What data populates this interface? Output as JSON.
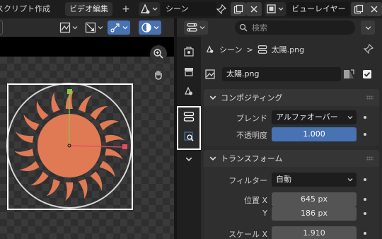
{
  "topbar": {
    "tab_partial": "スクリプト作成",
    "tab_active": "ビデオ編集",
    "plus": "+",
    "scene_name": "シーン",
    "layer_name": "ビューレイヤー"
  },
  "viewport": {
    "toolbar_icons": [
      "overlay-icon",
      "gizmo-icon",
      "transform-icon",
      "view-icon"
    ]
  },
  "properties": {
    "search_placeholder": "検索",
    "breadcrumb": {
      "scene": "シーン",
      "separator": ">",
      "strip": "太陽.png"
    },
    "strip_name": "太陽.png",
    "compositing": {
      "title": "コンポジティング",
      "blend_label": "ブレンド",
      "blend_value": "アルファオーバー",
      "opacity_label": "不透明度",
      "opacity_value": "1.000"
    },
    "transform": {
      "title": "トランスフォーム",
      "filter_label": "フィルター",
      "filter_value": "自動",
      "position_x_label": "位置 X",
      "position_x_value": "645 px",
      "position_y_label": "Y",
      "position_y_value": "186 px",
      "scale_x_label": "スケール X",
      "scale_x_value": "1.910"
    }
  },
  "colors": {
    "accent": "#4772b3",
    "sun": "#e07a55",
    "highlight": "#ffffff"
  }
}
